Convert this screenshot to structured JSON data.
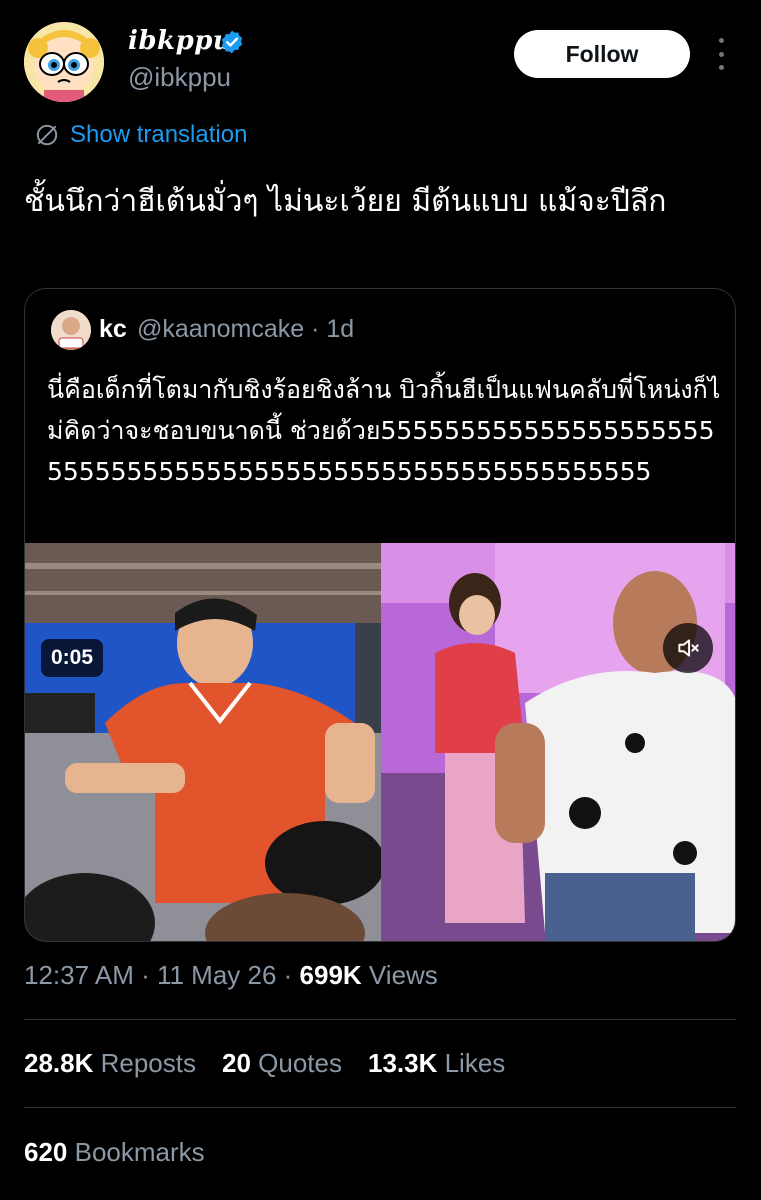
{
  "author": {
    "display_name": "ibkppu",
    "handle": "@ibkppu"
  },
  "follow_label": "Follow",
  "translation_label": "Show translation",
  "tweet_text": "ชั้นนึกว่าฮีเต้นมั่วๆ ไม่นะเว้ยย มีต้นแบบ แม้จะปีลึก",
  "quote": {
    "name": "kc",
    "handle_time": "@kaanomcake · 1d",
    "text": "นี่คือเด็กที่โตมากับชิงร้อยชิงล้าน บิวกิ้นฮีเป็นแฟนคลับพี่โหน่งก็ไม่คิดว่าจะชอบขนาดนี้ ช่วยด้วย55555555555555555555555555555555555555555555555555555555555",
    "video_duration": "0:05"
  },
  "meta": {
    "time": "12:37 AM · 11 May 26 · ",
    "views_count": "699K",
    "views_label": " Views"
  },
  "stats": {
    "reposts_count": "28.8K",
    "reposts_label": " Reposts",
    "quotes_count": "20",
    "quotes_label": " Quotes",
    "likes_count": "13.3K",
    "likes_label": " Likes",
    "bookmarks_count": "620",
    "bookmarks_label": " Bookmarks"
  },
  "colors": {
    "background": "#000000",
    "link": "#1d9bf0",
    "muted": "#8b98a5",
    "verified": "#1d9bf0"
  }
}
